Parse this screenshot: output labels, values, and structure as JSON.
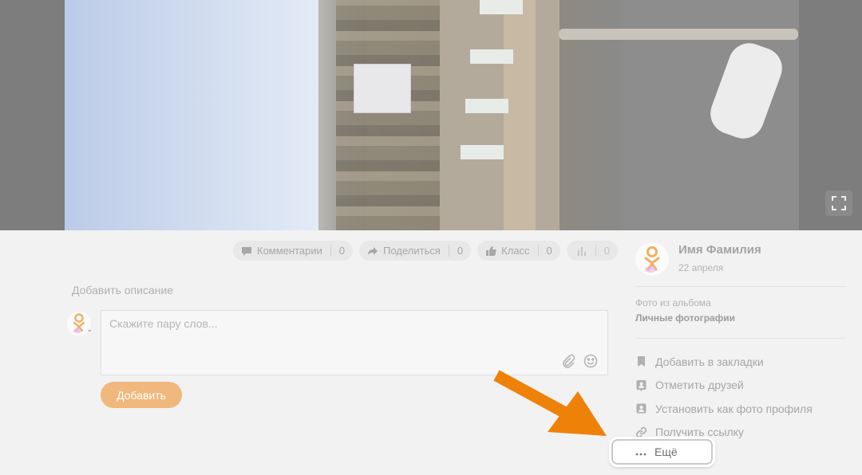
{
  "photo": {
    "expand_icon": "fullscreen-icon"
  },
  "actions": [
    {
      "label": "Комментарии",
      "count": "0",
      "icon": "comment-icon"
    },
    {
      "label": "Поделиться",
      "count": "0",
      "icon": "share-icon"
    },
    {
      "label": "Класс",
      "count": "0",
      "icon": "like-icon"
    },
    {
      "label": "",
      "count": "0",
      "icon": "stats-icon"
    }
  ],
  "description": {
    "placeholder": "Добавить описание"
  },
  "comment": {
    "placeholder": "Скажите пару слов...",
    "submit_label": "Добавить"
  },
  "owner": {
    "name": "Имя Фамилия",
    "date": "22 апреля"
  },
  "album": {
    "caption": "Фото из альбома",
    "name": "Личные фотографии"
  },
  "menu": [
    {
      "label": "Добавить в закладки",
      "icon": "bookmark-icon"
    },
    {
      "label": "Отметить друзей",
      "icon": "tag-friends-icon"
    },
    {
      "label": "Установить как фото профиля",
      "icon": "profile-photo-icon"
    },
    {
      "label": "Получить ссылку",
      "icon": "link-icon"
    }
  ],
  "more": {
    "label": "Ещё",
    "icon": "dots-icon"
  },
  "colors": {
    "accent": "#ee8208",
    "button": "#f0b87c",
    "page_bg": "#f2f2f2"
  }
}
